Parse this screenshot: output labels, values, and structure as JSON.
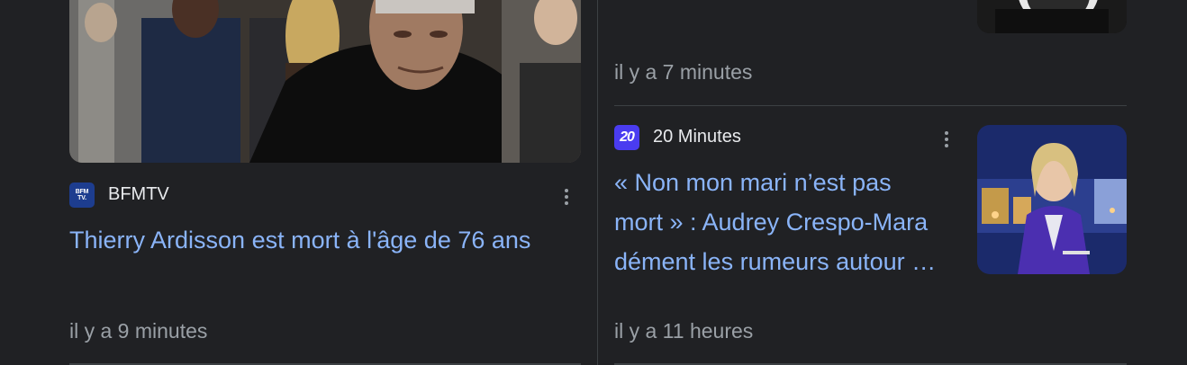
{
  "left_card": {
    "source": "BFMTV",
    "logo_text_top": "BFM",
    "logo_text_bottom": "TV.",
    "headline": "Thierry Ardisson est mort à l'âge de 76 ans",
    "time": "il y a 9 minutes"
  },
  "right_top_card": {
    "time": "il y a 7 minutes"
  },
  "right_card": {
    "source": "20 Minutes",
    "logo_text": "20",
    "headline_line1": "« Non mon mari n’est pas",
    "headline_line2": "mort » : Audrey Crespo-Mara",
    "headline_line3": "dément les rumeurs autour …",
    "time": "il y a 11 heures"
  },
  "colors": {
    "background": "#202124",
    "link": "#8ab4f8",
    "meta_text": "#9aa0a6",
    "source_text": "#e8eaed",
    "bfm_logo": "#1d3d8f",
    "twenty_logo": "#4a3cf0"
  },
  "icons": {
    "menu": "more-vert-icon"
  }
}
